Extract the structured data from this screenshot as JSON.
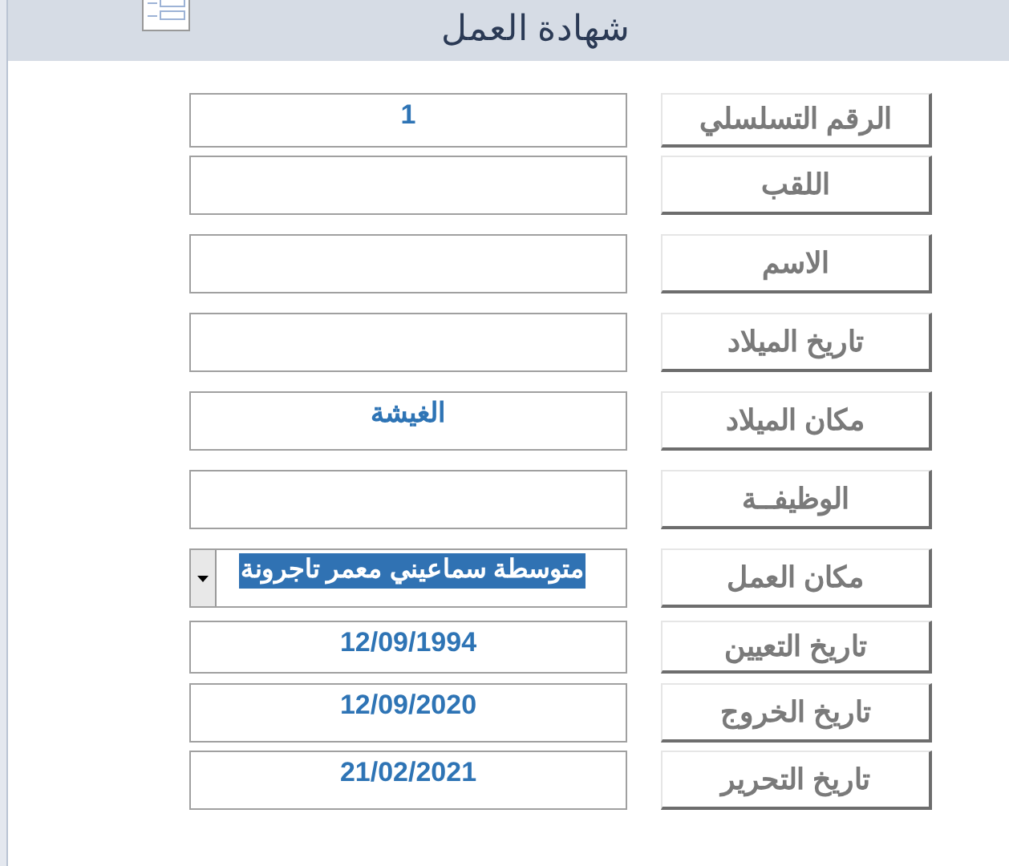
{
  "header": {
    "title": "شهادة العمل"
  },
  "fields": [
    {
      "label": "الرقم التسلسلي",
      "kind": "text",
      "value": "1"
    },
    {
      "label": "اللقب",
      "kind": "text"
    },
    {
      "label": "الاسم",
      "kind": "text"
    },
    {
      "label": "تاريخ الميلاد",
      "kind": "text"
    },
    {
      "label": "مكان الميلاد",
      "kind": "text",
      "value": "الغيشة"
    },
    {
      "label": "الوظيفــة",
      "kind": "text"
    },
    {
      "label": "مكان العمل",
      "kind": "combo",
      "value": "متوسطة سماعيني معمر تاجرونة",
      "highlighted": true
    },
    {
      "label": "تاريخ التعيين",
      "kind": "text",
      "value": "12/09/1994"
    },
    {
      "label": "تاريخ الخروج",
      "kind": "text",
      "value": "12/09/2020"
    },
    {
      "label": "تاريخ التحرير",
      "kind": "text",
      "value": "21/02/2021"
    }
  ]
}
